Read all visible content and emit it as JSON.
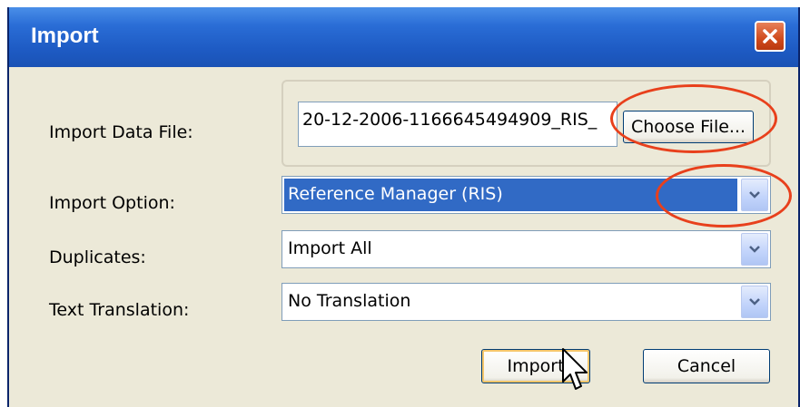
{
  "window": {
    "title": "Import"
  },
  "form": {
    "import_data_file_label": "Import Data File:",
    "import_data_file_value": "20-12-2006-1166645494909_RIS_",
    "choose_file_label": "Choose File...",
    "import_option_label": "Import Option:",
    "import_option_value": "Reference Manager (RIS)",
    "duplicates_label": "Duplicates:",
    "duplicates_value": "Import All",
    "text_translation_label": "Text Translation:",
    "text_translation_value": "No Translation"
  },
  "buttons": {
    "import": "Import",
    "cancel": "Cancel"
  },
  "icons": {
    "close": "close-icon",
    "dropdown": "chevron-down-icon",
    "cursor": "mouse-pointer-icon"
  },
  "colors": {
    "title_bar": "#1e5bc4",
    "selection": "#316ac5",
    "annotation": "#e8401c",
    "dialog_bg": "#ece9d8"
  }
}
